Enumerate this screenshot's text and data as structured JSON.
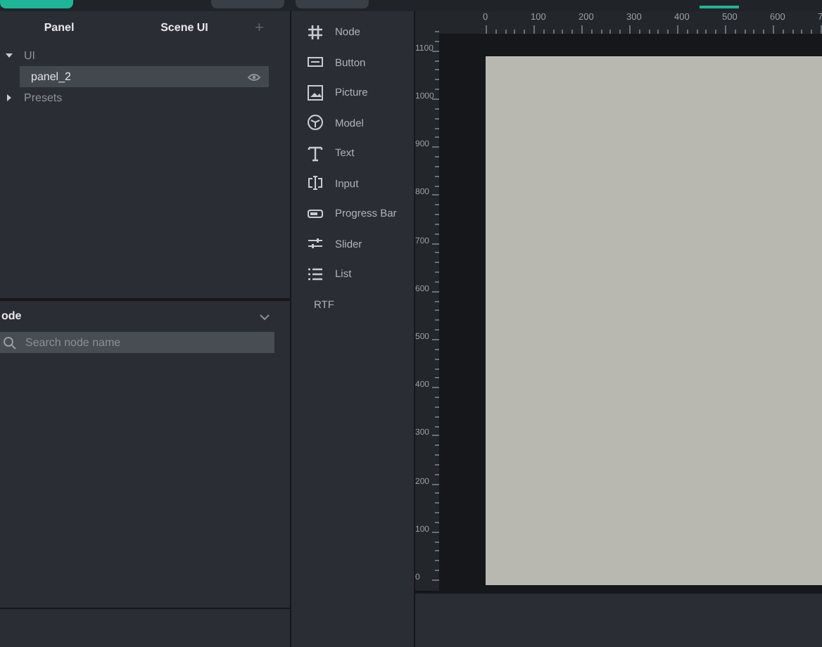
{
  "scene_panel": {
    "headers": [
      "Panel",
      "Scene UI"
    ],
    "add_label": "+",
    "tree": [
      {
        "label": "UI",
        "expanded": true,
        "children": [
          {
            "label": "panel_2",
            "selected": true,
            "visible": true
          }
        ]
      },
      {
        "label": "Presets",
        "expanded": false
      }
    ]
  },
  "node_panel": {
    "title": "ode",
    "search": {
      "placeholder": "Search node name"
    }
  },
  "components": [
    {
      "label": "Node",
      "kind": "grid"
    },
    {
      "label": "Button",
      "kind": "button"
    },
    {
      "label": "Picture",
      "kind": "picture"
    },
    {
      "label": "Model",
      "kind": "cube"
    },
    {
      "label": "Text",
      "kind": "text"
    },
    {
      "label": "Input",
      "kind": "input"
    },
    {
      "label": "Progress Bar",
      "kind": "progress"
    },
    {
      "label": "Slider",
      "kind": "slider"
    },
    {
      "label": "List",
      "kind": "list"
    },
    {
      "label": "RTF",
      "kind": "none"
    }
  ],
  "ruler": {
    "x_labels": [
      "0",
      "100",
      "200",
      "300",
      "400",
      "500",
      "600",
      "7"
    ],
    "y_labels": [
      "1100",
      "1000",
      "900",
      "800",
      "700",
      "600",
      "500",
      "400",
      "300",
      "200",
      "100",
      "0"
    ]
  }
}
